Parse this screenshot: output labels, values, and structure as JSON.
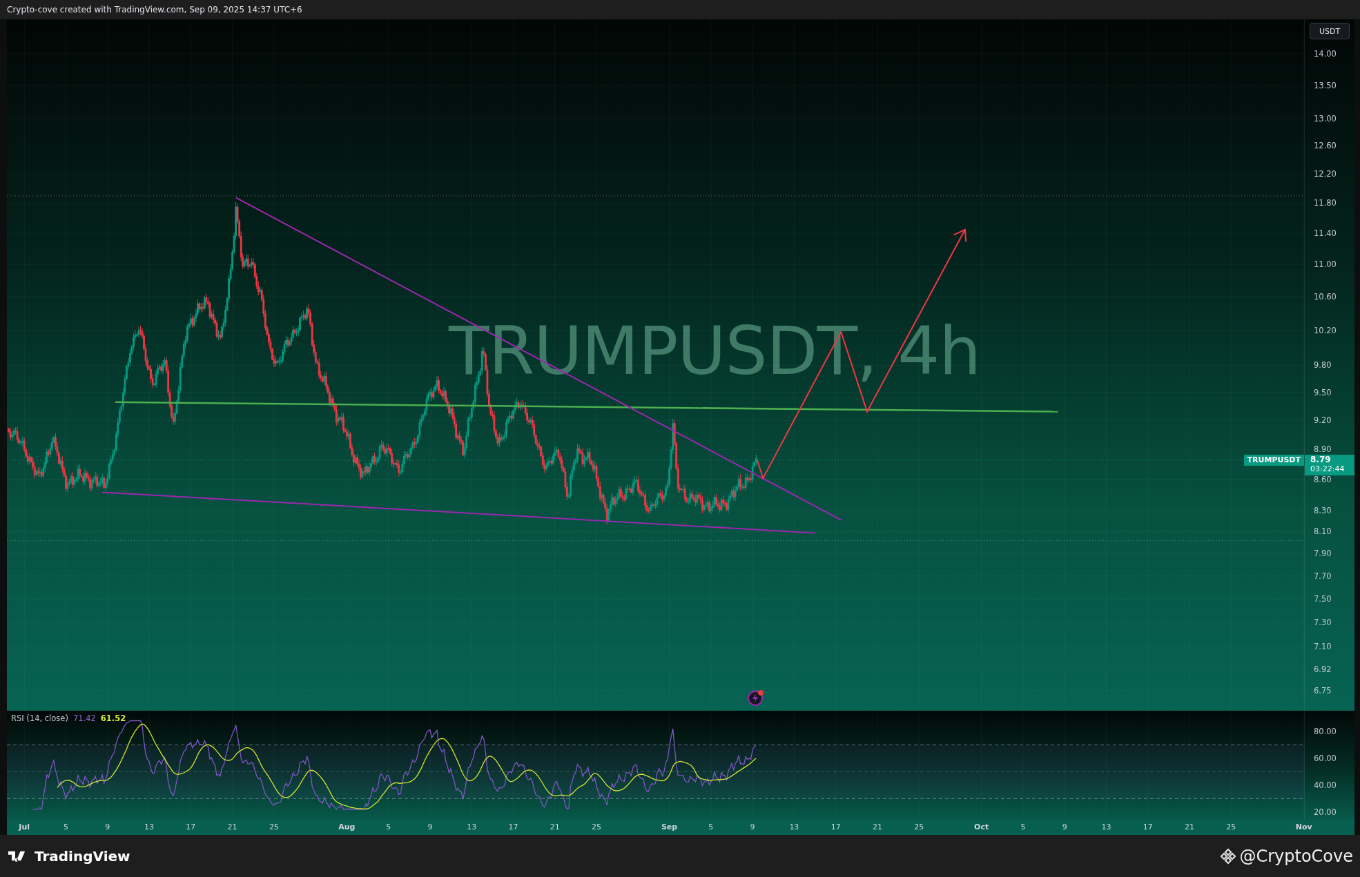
{
  "header": {
    "text": "Crypto-cove created with TradingView.com, Sep 09, 2025 14:37 UTC+6"
  },
  "chart": {
    "symbol_watermark": "TRUMPUSDT, 4h",
    "currency": "USDT",
    "price_ticks": [
      "14.00",
      "13.50",
      "13.00",
      "12.60",
      "12.20",
      "11.80",
      "11.40",
      "11.00",
      "10.60",
      "10.20",
      "9.80",
      "9.50",
      "9.20",
      "8.90",
      "8.60",
      "8.30",
      "8.10",
      "7.90",
      "7.70",
      "7.50",
      "7.30",
      "7.10",
      "6.92",
      "6.75"
    ],
    "last_price": {
      "symbol": "TRUMPUSDT",
      "price": "8.79",
      "countdown": "03:22:44"
    }
  },
  "rsi": {
    "label": "RSI (14, close)",
    "value": "71.42",
    "ma_value": "61.52",
    "ticks": [
      "80.00",
      "60.00",
      "40.00",
      "20.00"
    ]
  },
  "date_axis": {
    "labels": [
      "Jul",
      "5",
      "9",
      "13",
      "17",
      "21",
      "25",
      "Aug",
      "5",
      "9",
      "13",
      "17",
      "21",
      "25",
      "Sep",
      "5",
      "9",
      "13",
      "17",
      "21",
      "25",
      "Oct",
      "5",
      "9",
      "13",
      "17",
      "21",
      "25",
      "Nov"
    ]
  },
  "footer": {
    "brand": "TradingView",
    "author": "@CryptoCove"
  }
}
